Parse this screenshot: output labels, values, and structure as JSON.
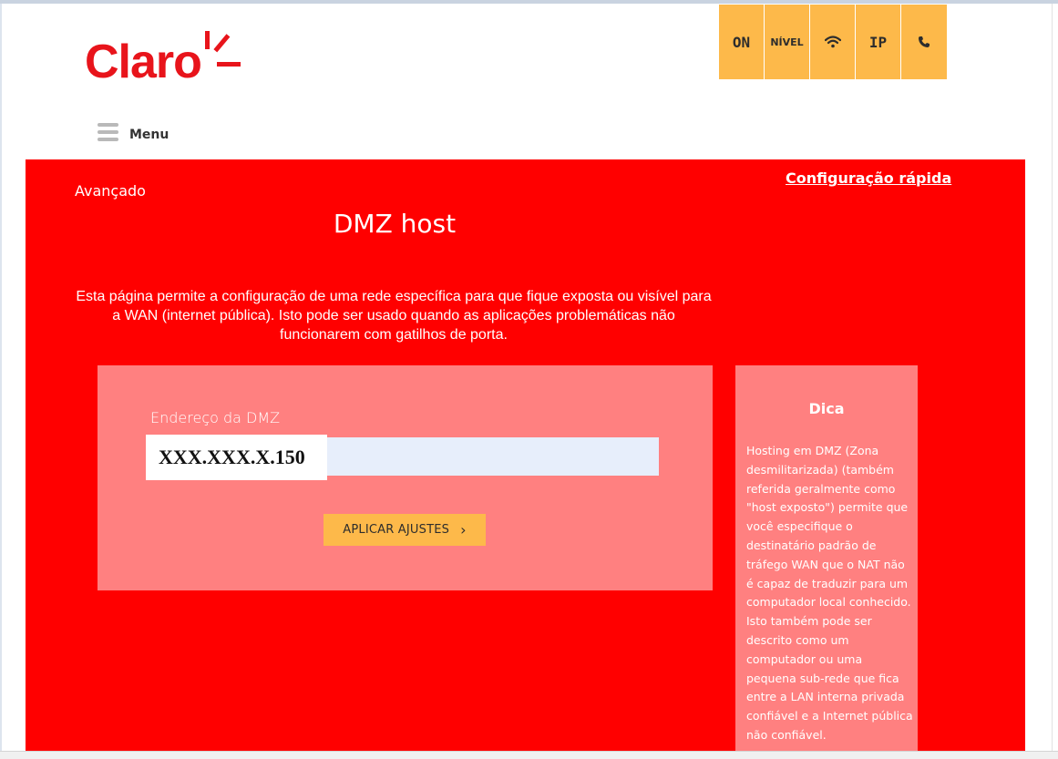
{
  "brand": {
    "logo_text": "Claro",
    "color": "#e8141b"
  },
  "status_bar": [
    {
      "label": "ON",
      "icon": null
    },
    {
      "label": "NÍVEL",
      "icon": null
    },
    {
      "label": "",
      "icon": "wifi-icon"
    },
    {
      "label": "IP",
      "icon": null
    },
    {
      "label": "",
      "icon": "phone-icon"
    }
  ],
  "menu": {
    "label": "Menu"
  },
  "main": {
    "breadcrumb": "Avançado",
    "quick_config_link": "Configuração rápida",
    "title": "DMZ host",
    "description": "Esta página permite a configuração de uma rede específica para que fique exposta ou visível para a WAN (internet pública). Isto pode ser usado quando as aplicações problemáticas não funcionarem com gatilhos de porta.",
    "form": {
      "dmz_label": "Endereço da DMZ",
      "dmz_value": "XXX.XXX.X.150",
      "apply_label": "APLICAR AJUSTES"
    },
    "tip": {
      "title": "Dica",
      "text": "Hosting em DMZ (Zona desmilitarizada) (também referida geralmente como \"host exposto\") permite que você especifique o destinatário padrão de tráfego WAN que o NAT não é capaz de traduzir para um computador local conhecido. Isto também pode ser descrito como um computador ou uma pequena sub-rede que fica entre a LAN interna privada confiável e a Internet pública não confiável."
    }
  },
  "colors": {
    "panel_red": "#ff0000",
    "panel_pink": "#ff8080",
    "accent_orange": "#fdb94a"
  }
}
